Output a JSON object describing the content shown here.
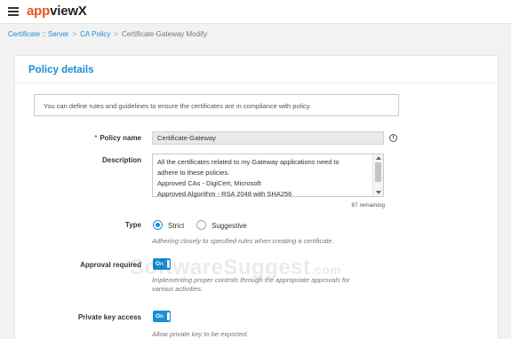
{
  "header": {
    "logo_prefix": "app",
    "logo_suffix": "viewX"
  },
  "breadcrumb": {
    "items": [
      "Certificate :: Server",
      "CA Policy"
    ],
    "current": "Certificate-Gateway Modify"
  },
  "panel": {
    "title": "Policy details",
    "info": "You can define rules and guidelines to ensure the certificates are in compliance with policy."
  },
  "form": {
    "policy_name": {
      "label": "Policy name",
      "required_mark": "*",
      "value": "Certificate-Gateway",
      "info_icon": "info-icon"
    },
    "description": {
      "label": "Description",
      "lines": [
        "All the certificates related to my Gateway applications need to",
        "adhere to these policies.",
        "Approved CAs - DigiCert, Microsoft",
        "Approved Algorithm - RSA 2048 with SHA256"
      ],
      "remaining": "87 remaining"
    },
    "type": {
      "label": "Type",
      "options": [
        "Strict",
        "Suggestive"
      ],
      "selected": "Strict",
      "help": "Adhering closely to specified rules when creating a certificate."
    },
    "approval_required": {
      "label": "Approval required",
      "toggle": "On",
      "help_lines": [
        "Implementing proper controls through the appropriate approvals for",
        "various activities."
      ]
    },
    "private_key_access": {
      "label": "Private key access",
      "toggle": "On",
      "help": "Allow private key to be exported."
    }
  },
  "watermark": {
    "text": "SoftwareSuggest",
    "suffix": ".com"
  },
  "colors": {
    "accent": "#1a8ed6",
    "brand": "#e8531f"
  }
}
